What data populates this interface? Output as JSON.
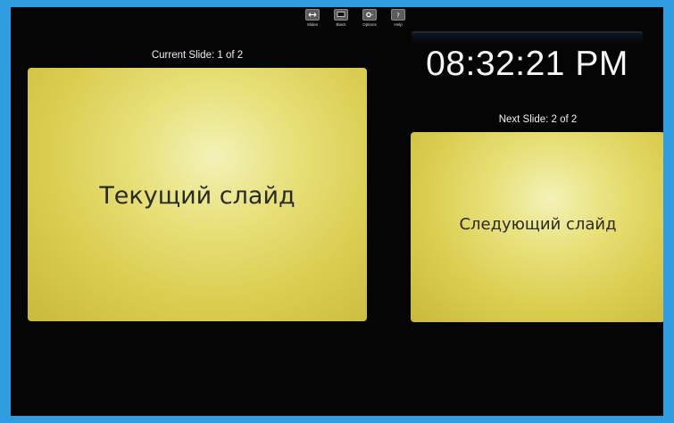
{
  "toolbar": {
    "items": [
      {
        "label": "Slides",
        "icon": "slides-icon"
      },
      {
        "label": "Black",
        "icon": "black-screen-icon"
      },
      {
        "label": "Options",
        "icon": "gear-icon"
      },
      {
        "label": "Help",
        "icon": "help-icon"
      }
    ]
  },
  "current": {
    "caption": "Current Slide: 1 of 2",
    "slide_text": "Текущий слайд"
  },
  "next": {
    "caption": "Next Slide: 2 of 2",
    "slide_text": "Следующий слайд"
  },
  "clock": {
    "time": "08:32:21 PM"
  },
  "colors": {
    "background": "#050505",
    "slide": "#e2d65e",
    "frame": "#2f9de0"
  }
}
